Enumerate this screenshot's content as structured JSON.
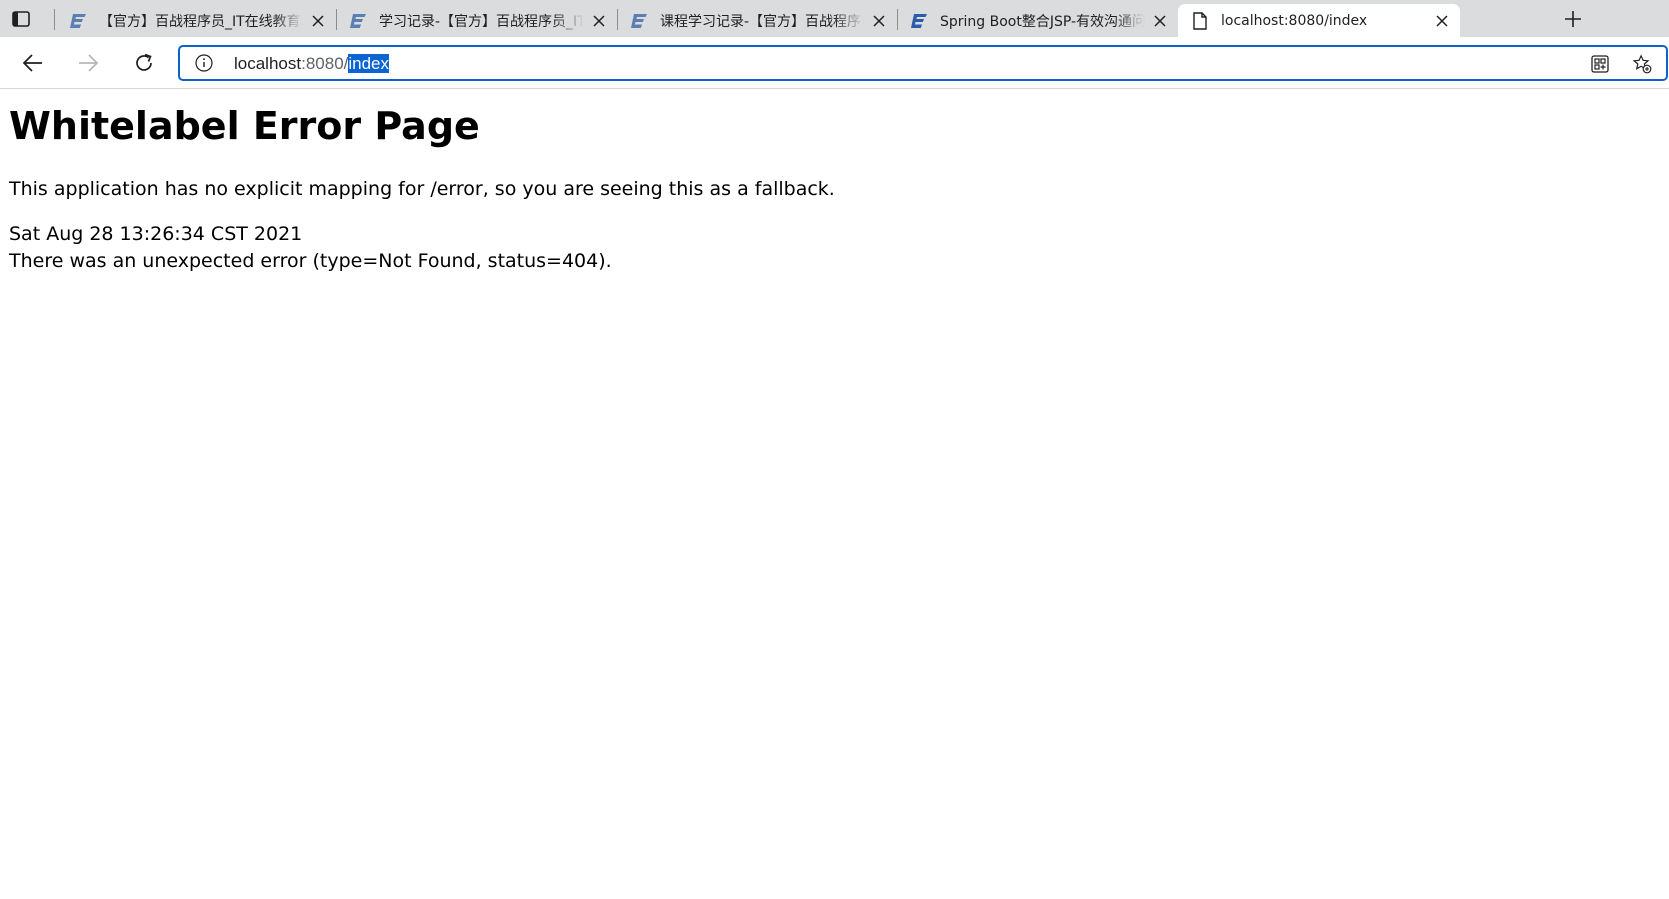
{
  "tabs": [
    {
      "title": "【官方】百战程序员_IT在线教育培训机构",
      "active": false,
      "favicon": "bz-logo-icon"
    },
    {
      "title": "学习记录-【官方】百战程序员_IT在线教育",
      "active": false,
      "favicon": "bz-logo-icon"
    },
    {
      "title": "课程学习记录-【官方】百战程序员_IT在线",
      "active": false,
      "favicon": "bz-logo-icon"
    },
    {
      "title": "Spring Boot整合JSP-有效沟通问答",
      "active": false,
      "favicon": "bz-logo-icon"
    },
    {
      "title": "localhost:8080/index",
      "active": true,
      "favicon": "page-icon"
    }
  ],
  "address_bar": {
    "host": "localhost",
    "port": ":8080/",
    "path_selected": "index"
  },
  "page": {
    "title": "Whitelabel Error Page",
    "message": "This application has no explicit mapping for /error, so you are seeing this as a fallback.",
    "timestamp": "Sat Aug 28 13:26:34 CST 2021",
    "error": "There was an unexpected error (type=Not Found, status=404)."
  },
  "colors": {
    "tabstrip_bg": "#dadcde",
    "omnibox_border": "#0d63c9",
    "selection": "#0a64d3",
    "favicon_blue": "#5a7fb0"
  }
}
